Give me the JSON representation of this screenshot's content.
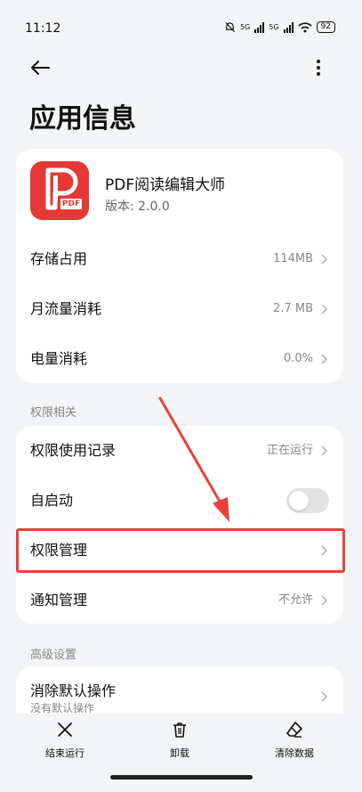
{
  "status": {
    "time": "11:12",
    "net1": "5G",
    "net2": "5G",
    "battery": "92"
  },
  "page": {
    "title": "应用信息"
  },
  "app": {
    "name": "PDF阅读编辑大师",
    "version": "版本: 2.0.0",
    "icon_text": "PDF",
    "icon_color": "#e53935"
  },
  "usage": [
    {
      "label": "存储占用",
      "value": "114MB"
    },
    {
      "label": "月流量消耗",
      "value": "2.7 MB"
    },
    {
      "label": "电量消耗",
      "value": "0.0%"
    }
  ],
  "permissions": {
    "section": "权限相关",
    "usage_record": {
      "label": "权限使用记录",
      "value": "正在运行"
    },
    "autostart": {
      "label": "自启动",
      "enabled": false
    },
    "manage": {
      "label": "权限管理"
    },
    "notify": {
      "label": "通知管理",
      "value": "不允许"
    }
  },
  "advanced": {
    "section": "高级设置",
    "clear_default": {
      "label": "消除默认操作",
      "sub": "没有默认操作"
    }
  },
  "bottom": {
    "stop": "结束运行",
    "uninstall": "卸载",
    "clear": "清除数据"
  },
  "colors": {
    "accent_red": "#e8413a"
  }
}
